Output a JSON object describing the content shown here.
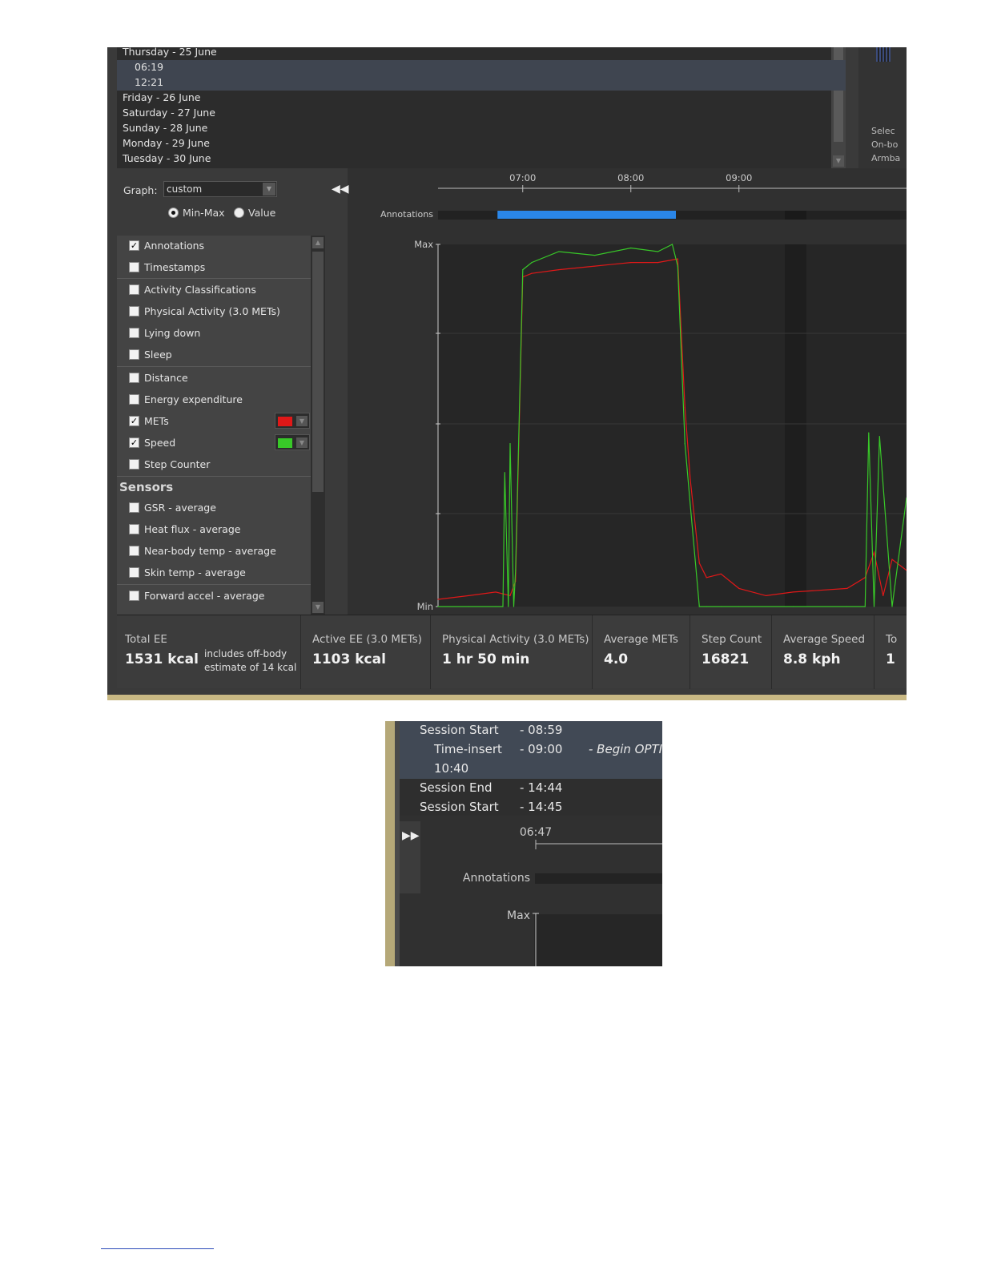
{
  "day_list": {
    "rows": [
      {
        "label": "Thursday - 25 June",
        "sub": false,
        "selected": false
      },
      {
        "label": "06:19",
        "sub": true,
        "selected": true
      },
      {
        "label": "12:21",
        "sub": true,
        "selected": true
      },
      {
        "label": "Friday - 26 June",
        "sub": false,
        "selected": false
      },
      {
        "label": "Saturday - 27 June",
        "sub": false,
        "selected": false
      },
      {
        "label": "Sunday - 28 June",
        "sub": false,
        "selected": false
      },
      {
        "label": "Monday - 29 June",
        "sub": false,
        "selected": false
      },
      {
        "label": "Tuesday - 30 June",
        "sub": false,
        "selected": false
      }
    ]
  },
  "right_pane": {
    "lines": [
      "Selec",
      "On-bo",
      "Armba"
    ]
  },
  "controls": {
    "graph_label": "Graph:",
    "graph_value": "custom",
    "radio_minmax": "Min-Max",
    "radio_value": "Value",
    "radio_selected": "minmax",
    "sensors_header": "Sensors",
    "layers": [
      {
        "label": "Annotations",
        "checked": true
      },
      {
        "label": "Timestamps",
        "checked": false
      },
      {
        "label": "Activity Classifications",
        "checked": false
      },
      {
        "label": "Physical Activity (3.0 METs)",
        "checked": false
      },
      {
        "label": "Lying down",
        "checked": false
      },
      {
        "label": "Sleep",
        "checked": false
      },
      {
        "label": "Distance",
        "checked": false
      },
      {
        "label": "Energy expenditure",
        "checked": false
      },
      {
        "label": "METs",
        "checked": true,
        "color": "#e01818"
      },
      {
        "label": "Speed",
        "checked": true,
        "color": "#38c828"
      },
      {
        "label": "Step Counter",
        "checked": false
      },
      {
        "label": "GSR - average",
        "checked": false
      },
      {
        "label": "Heat flux - average",
        "checked": false
      },
      {
        "label": "Near-body temp - average",
        "checked": false
      },
      {
        "label": "Skin temp - average",
        "checked": false
      },
      {
        "label": "Forward accel - average",
        "checked": false
      }
    ]
  },
  "chart": {
    "time_ticks": [
      "07:00",
      "08:00",
      "09:00"
    ],
    "annotations_label": "Annotations",
    "y_max_label": "Max",
    "y_min_label": "Min",
    "annotation_color": "#2a86e8",
    "mets_color": "#e01818",
    "speed_color": "#38c828"
  },
  "chart_data": {
    "type": "line",
    "x_range": [
      "06:13",
      "10:33"
    ],
    "ylim": [
      0,
      1
    ],
    "annotation_span": [
      "06:46",
      "08:25"
    ],
    "series": [
      {
        "name": "METs",
        "color": "#e01818",
        "x": [
          "06:13",
          "06:30",
          "06:45",
          "06:53",
          "06:56",
          "07:00",
          "07:05",
          "07:20",
          "07:40",
          "08:00",
          "08:15",
          "08:26",
          "08:30",
          "08:33",
          "08:38",
          "08:42",
          "08:50",
          "09:00",
          "09:15",
          "09:30",
          "10:00",
          "10:10",
          "10:15",
          "10:20",
          "10:25",
          "10:33"
        ],
        "values": [
          0.02,
          0.03,
          0.04,
          0.03,
          0.07,
          0.91,
          0.92,
          0.93,
          0.94,
          0.95,
          0.95,
          0.96,
          0.55,
          0.35,
          0.12,
          0.08,
          0.09,
          0.05,
          0.03,
          0.04,
          0.05,
          0.08,
          0.15,
          0.03,
          0.13,
          0.1
        ]
      },
      {
        "name": "Speed",
        "color": "#38c828",
        "x": [
          "06:13",
          "06:30",
          "06:45",
          "06:49",
          "06:50",
          "06:52",
          "06:53",
          "06:55",
          "06:56",
          "07:00",
          "07:05",
          "07:20",
          "07:40",
          "08:00",
          "08:15",
          "08:23",
          "08:26",
          "08:30",
          "08:33",
          "08:38",
          "08:42",
          "08:50",
          "09:00",
          "09:30",
          "10:00",
          "10:10",
          "10:12",
          "10:15",
          "10:18",
          "10:25",
          "10:33"
        ],
        "values": [
          0,
          0,
          0,
          0,
          0.37,
          0,
          0.45,
          0,
          0.1,
          0.93,
          0.95,
          0.98,
          0.97,
          0.99,
          0.98,
          1.0,
          0.94,
          0.45,
          0.28,
          0,
          0,
          0,
          0,
          0,
          0,
          0,
          0.48,
          0,
          0.47,
          0,
          0.3
        ]
      }
    ]
  },
  "stats": {
    "total_ee_label": "Total EE",
    "total_ee_value": "1531 kcal",
    "total_ee_note_1": "includes off-body",
    "total_ee_note_2": "estimate of 14 kcal",
    "active_ee_label": "Active EE (3.0 METs)",
    "active_ee_value": "1103 kcal",
    "pa_label": "Physical Activity (3.0 METs)",
    "pa_value": "1 hr 50 min",
    "avg_mets_label": "Average METs",
    "avg_mets_value": "4.0",
    "steps_label": "Step Count",
    "steps_value": "16821",
    "avg_speed_label": "Average Speed",
    "avg_speed_value": "8.8 kph",
    "cut_label": "To",
    "cut_value": "1"
  },
  "sessions": {
    "rows": [
      {
        "name": "Session Start",
        "time": "- 08:59",
        "note": ""
      },
      {
        "name": "Time-insert",
        "time": "- 09:00",
        "note": "- Begin OPTI"
      },
      {
        "name": "10:40",
        "time": "",
        "note": ""
      },
      {
        "name": "Session End",
        "time": "- 14:44",
        "note": ""
      },
      {
        "name": "Session Start",
        "time": "- 14:45",
        "note": ""
      }
    ],
    "tick_label": "06:47",
    "annotations_label": "Annotations",
    "max_label": "Max"
  }
}
